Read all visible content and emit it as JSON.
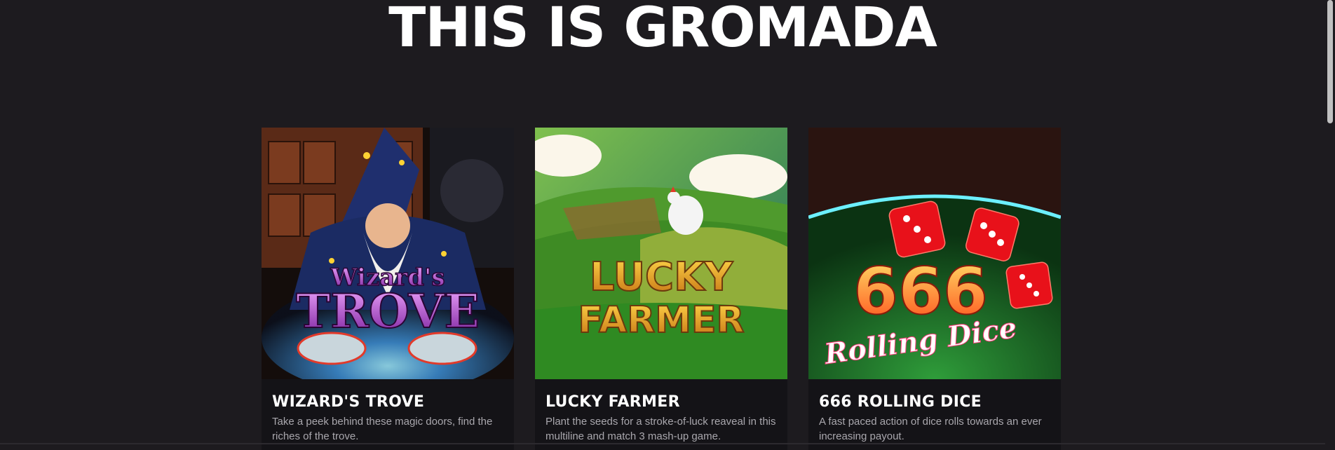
{
  "page": {
    "title": "THIS IS GROMADA"
  },
  "games": [
    {
      "title": "WIZARD'S TROVE",
      "art_line1": "Wizard's",
      "art_line2": "TROVE",
      "description": "Take a peek behind these magic doors, find the riches of the trove."
    },
    {
      "title": "LUCKY FARMER",
      "art_line1": "LUCKY",
      "art_line2": "FARMER",
      "description": "Plant the seeds for a stroke-of-luck reaveal in this multiline and match 3 mash-up game."
    },
    {
      "title": "666 ROLLING DICE",
      "art_line1": "666",
      "art_line2": "Rolling Dice",
      "description": "A fast paced action of dice rolls towards an ever increasing payout."
    }
  ],
  "colors": {
    "background": "#1d1b1f",
    "card": "#141317",
    "text_muted": "#a9a7ad"
  }
}
